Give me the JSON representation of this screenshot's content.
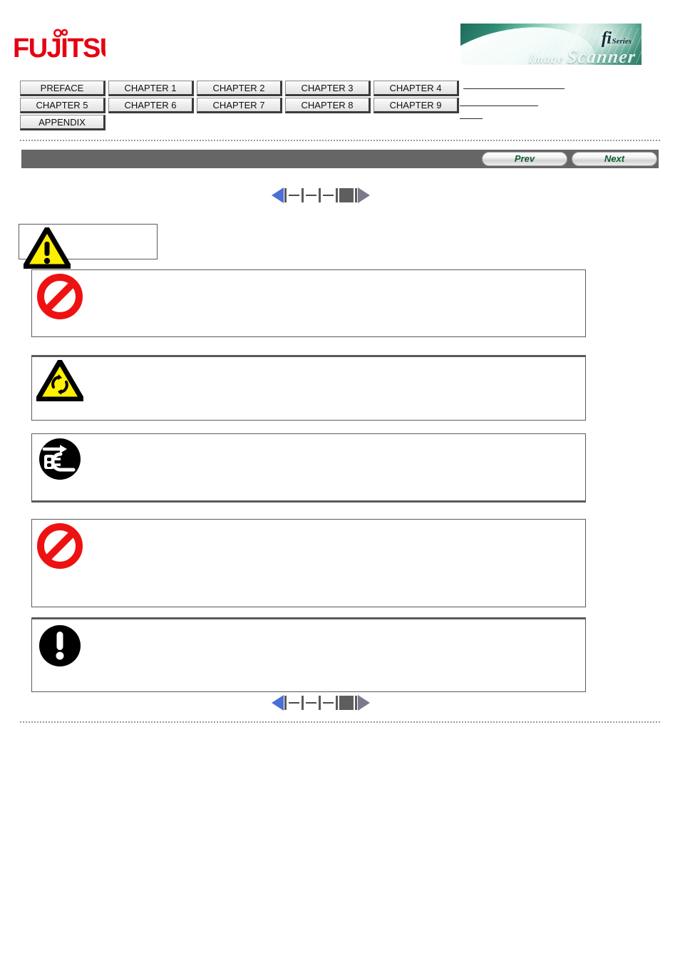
{
  "header": {
    "logo_text": "FUJITSU",
    "banner": {
      "fi_text": "fi",
      "series_text": "Series",
      "product_small": "Image",
      "product_script": "Scanner"
    }
  },
  "tabnav": {
    "rows": [
      [
        {
          "label": "PREFACE",
          "name": "tab-preface"
        },
        {
          "label": "CHAPTER 1",
          "name": "tab-chapter-1"
        },
        {
          "label": "CHAPTER 2",
          "name": "tab-chapter-2"
        },
        {
          "label": "CHAPTER 3",
          "name": "tab-chapter-3"
        },
        {
          "label": "CHAPTER 4",
          "name": "tab-chapter-4"
        }
      ],
      [
        {
          "label": "CHAPTER 5",
          "name": "tab-chapter-5"
        },
        {
          "label": "CHAPTER 6",
          "name": "tab-chapter-6"
        },
        {
          "label": "CHAPTER 7",
          "name": "tab-chapter-7"
        },
        {
          "label": "CHAPTER 8",
          "name": "tab-chapter-8"
        },
        {
          "label": "CHAPTER 9",
          "name": "tab-chapter-9"
        }
      ],
      [
        {
          "label": "APPENDIX",
          "name": "tab-appendix"
        }
      ]
    ]
  },
  "toolbar": {
    "prev_label": "Prev",
    "next_label": "Next"
  },
  "pager": {
    "prev_arrow_icon": "triangle-left-icon",
    "next_arrow_icon": "triangle-right-icon",
    "current_marker_icon": "current-page-block-icon",
    "separator_icon": "vertical-bar-icon",
    "dash_icon": "dash-icon",
    "prev_enabled_color": "#4a6fd6",
    "next_disabled_color": "#7a7a8a",
    "current_color": "#5e5e5e"
  },
  "notices": [
    {
      "name": "notice-heading-box",
      "icon": "warning-triangle-exclamation-icon",
      "icon_colors": {
        "fill": "#fff000",
        "stroke": "#000000"
      },
      "text": ""
    },
    {
      "name": "notice-prohibition-1",
      "icon": "prohibition-no-entry-icon",
      "icon_colors": {
        "fill": "#ee1111",
        "stroke": "#ee1111"
      },
      "text": ""
    },
    {
      "name": "notice-entanglement",
      "icon": "warning-triangle-rotating-parts-icon",
      "icon_colors": {
        "fill": "#fff000",
        "stroke": "#000000"
      },
      "text": ""
    },
    {
      "name": "notice-unplug",
      "icon": "unplug-power-cord-icon",
      "icon_colors": {
        "fill": "#000000",
        "stroke": "#ffffff"
      },
      "text": ""
    },
    {
      "name": "notice-prohibition-2",
      "icon": "prohibition-no-entry-icon",
      "icon_colors": {
        "fill": "#ee1111",
        "stroke": "#ee1111"
      },
      "text": ""
    },
    {
      "name": "notice-mandatory",
      "icon": "mandatory-action-exclamation-icon",
      "icon_colors": {
        "fill": "#000000",
        "stroke": "#ffffff"
      },
      "text": ""
    }
  ],
  "colors": {
    "fujitsu_red": "#e60012",
    "navbar_gray": "#666666",
    "button_text_green": "#0f5c2e",
    "box_border": "#5a5a5a"
  }
}
